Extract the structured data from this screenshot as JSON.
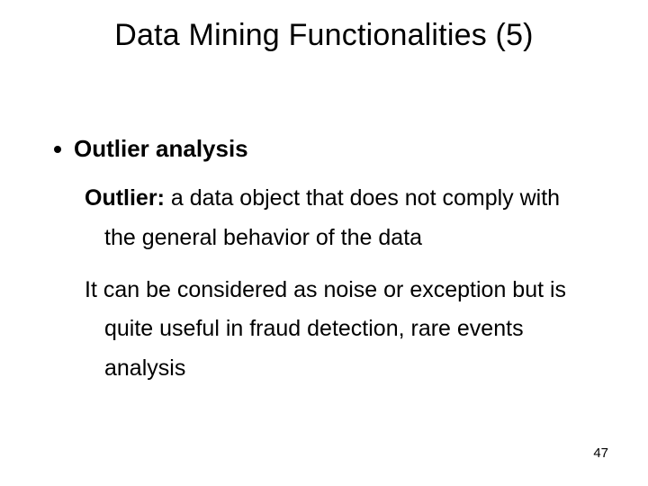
{
  "title": "Data Mining Functionalities (5)",
  "bullet": "Outlier analysis",
  "p1_bold": "Outlier:",
  "p1_rest": " a data object that does not comply with the general behavior of the data",
  "p2": "It can be considered as noise or exception but is quite useful in fraud detection, rare events analysis",
  "page": "47"
}
